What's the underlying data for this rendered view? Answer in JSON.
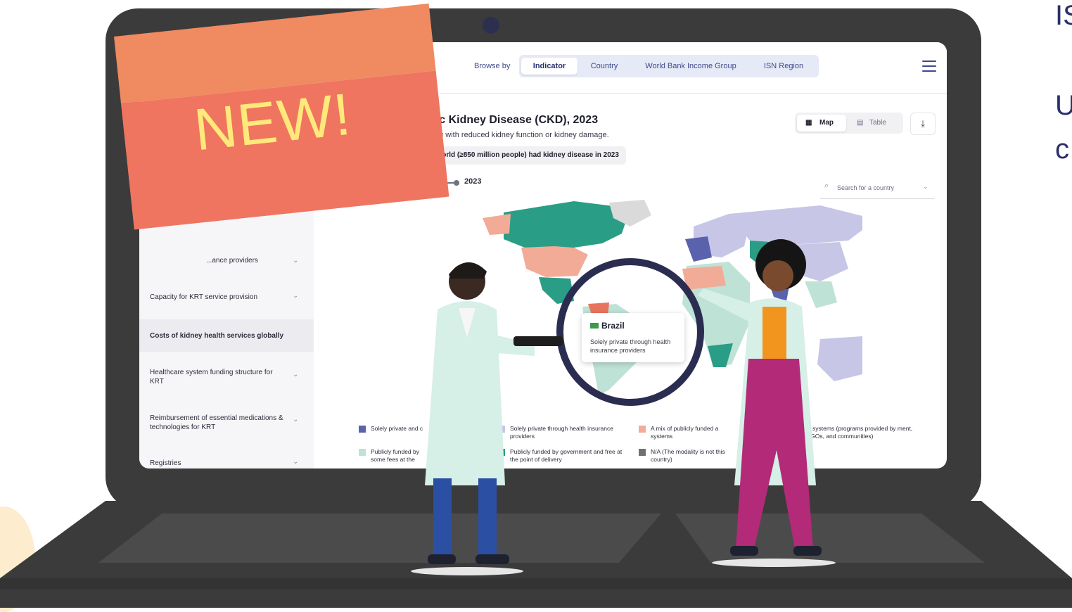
{
  "right_edge": {
    "line1": "IS",
    "line2": "U",
    "line3": "c"
  },
  "banner": {
    "text": "NEW!"
  },
  "nav": {
    "browse_label": "Browse by",
    "tabs": [
      "Indicator",
      "Country",
      "World Bank Income Group",
      "ISN Region"
    ],
    "active_tab": "Indicator"
  },
  "sidebar": {
    "items": [
      {
        "label": "...ance providers",
        "chevron": "chevron-down-icon"
      },
      {
        "label": "Capacity for KRT service provision",
        "chevron": "chevron-down-icon"
      },
      {
        "label": "Costs of kidney health services globally",
        "active": true
      },
      {
        "label": "Healthcare system funding structure for KRT",
        "chevron": "chevron-down-icon"
      },
      {
        "label": "Reimbursement of essential medications & technologies for KRT",
        "chevron": "chevron-down-icon"
      },
      {
        "label": "Registries",
        "chevron": "chevron-down-icon"
      }
    ]
  },
  "indicator": {
    "title": "ronic Kidney Disease (CKD), 2023",
    "subtitle": "n living with reduced kidney function or kidney damage.",
    "highlight": "he world (≥850 million people) had kidney disease in 2023",
    "year": "2023"
  },
  "view_toggle": {
    "map": "Map",
    "table": "Table",
    "active": "Map"
  },
  "search": {
    "placeholder": "Search for a country"
  },
  "tooltip": {
    "country": "Brazil",
    "description": "Solely private through health insurance providers"
  },
  "legend": {
    "items": [
      {
        "label": "Solely private and c",
        "color": "#5b62ad"
      },
      {
        "label": "Solely private through health insurance providers",
        "color": "#c7c6e6"
      },
      {
        "label": "A mix of publicly funded a systems",
        "color": "#f2ab96"
      },
      {
        "label": "le systems (programs provided by ment, NGOs, and communities)",
        "color": "#ffffff"
      },
      {
        "label": "Publicly funded by some fees at the",
        "color": "#bfe2d6"
      },
      {
        "label": "Publicly funded by government and free at the point of delivery",
        "color": "#2a9d86"
      },
      {
        "label": "N/A (The modality is not this country)",
        "color": "#707070"
      }
    ]
  },
  "colors": {
    "accent": "#3e4a8a",
    "banner_top": "#f08a60",
    "banner_bottom": "#ef7560",
    "banner_text": "#ffe97a",
    "laptop": "#3b3b3b"
  }
}
